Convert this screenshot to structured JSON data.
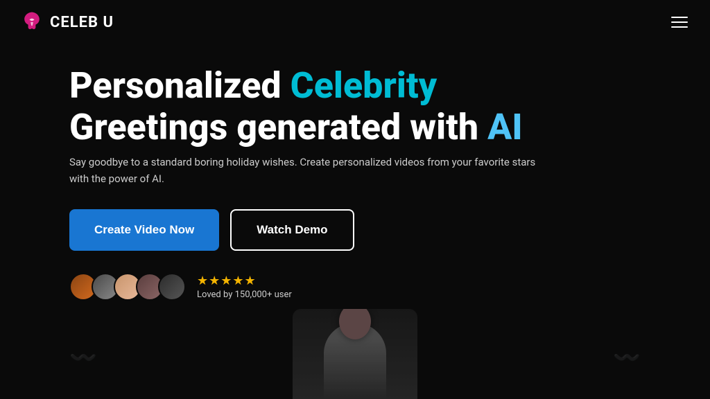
{
  "brand": {
    "name": "CELEB U",
    "logoAlt": "Celeb U Logo"
  },
  "nav": {
    "hamburger_label": "Menu"
  },
  "hero": {
    "title_part1": "Personalized ",
    "title_highlight1": "Celebrity",
    "title_part2": "Greetings generated with ",
    "title_highlight2": "AI",
    "subtitle": "Say goodbye to a standard boring holiday wishes. Create personalized videos from your favorite stars with the power of AI.",
    "cta_primary": "Create Video Now",
    "cta_secondary": "Watch Demo"
  },
  "social_proof": {
    "stars": "★★★★★",
    "text": "Loved by 150,000+ user",
    "avatars": [
      {
        "id": 1,
        "label": "User 1"
      },
      {
        "id": 2,
        "label": "User 2"
      },
      {
        "id": 3,
        "label": "User 3"
      },
      {
        "id": 4,
        "label": "User 4"
      },
      {
        "id": 5,
        "label": "User 5"
      }
    ]
  },
  "colors": {
    "accent_cyan": "#00bcd4",
    "accent_blue": "#4fc3f7",
    "btn_primary_bg": "#1976d2",
    "star_color": "#f4b400"
  }
}
